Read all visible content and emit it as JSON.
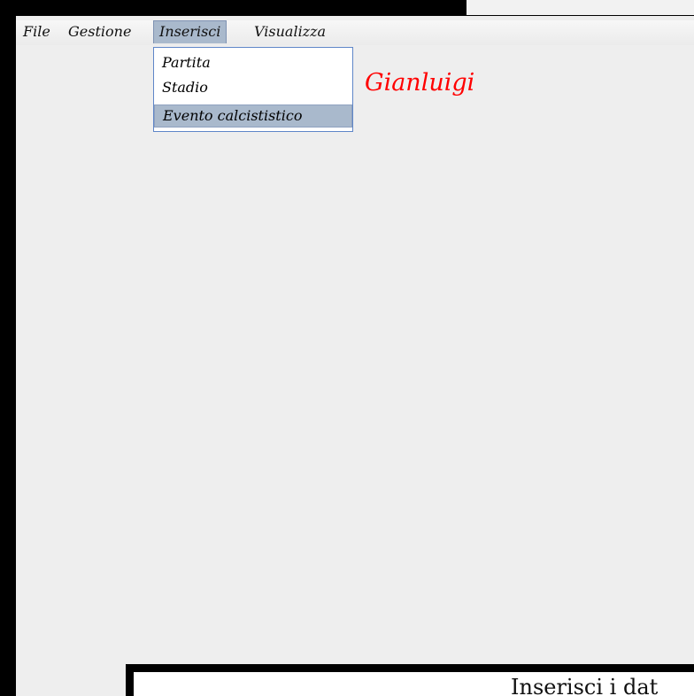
{
  "menubar": {
    "items": [
      {
        "label": "File"
      },
      {
        "label": "Gestione"
      },
      {
        "label": "Inserisci"
      },
      {
        "label": "Visualizza"
      }
    ],
    "open_index": 2
  },
  "dropdown": {
    "items": [
      {
        "label": "Partita"
      },
      {
        "label": "Stadio"
      },
      {
        "label": "Evento calcististico"
      }
    ],
    "highlighted_index": 2
  },
  "user": {
    "name": "Gianluigi",
    "color": "#ff0000"
  },
  "inner_window": {
    "title": "Inserisci i dat"
  },
  "colors": {
    "menu_highlight": "#a9b9cc",
    "dropdown_border": "#5f86c8",
    "window_bg": "#eeeeee"
  }
}
